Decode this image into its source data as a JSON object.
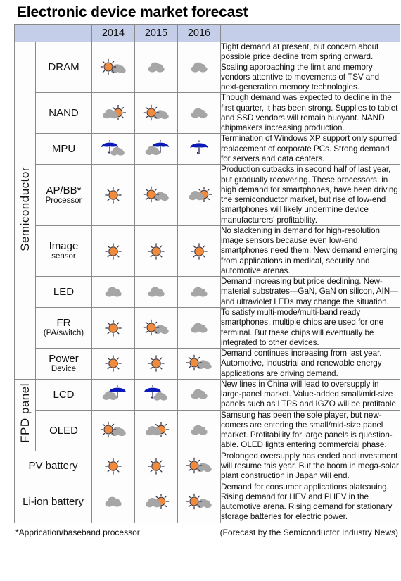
{
  "title": "Electronic device market forecast",
  "colors": {
    "header_band": "#c5cee8",
    "sun": "#f08a3c",
    "cloud": "#a6a6a6",
    "umbrella": "#0b19b9",
    "grid": "#8a8a8a"
  },
  "header": {
    "blank_label": "",
    "years": [
      "2014",
      "2015",
      "2016"
    ],
    "desc_label": ""
  },
  "groups": [
    {
      "label": "Semiconductor",
      "row_count": 8
    },
    {
      "label": "FPD panel",
      "row_count": 2
    }
  ],
  "rows": [
    {
      "group": "Semiconductor",
      "name": "DRAM",
      "sub": "",
      "icons": [
        "sun-cloud",
        "cloud",
        "cloud"
      ],
      "description": "Tight demand at present, but concern about possible price decline from spring onward. Scaling approaching the limit and memory vendors attentive to movements of TSV and next-generation memory technologies."
    },
    {
      "group": "Semiconductor",
      "name": "NAND",
      "sub": "",
      "icons": [
        "cloud-sun",
        "sun-cloud",
        "cloud"
      ],
      "description": "Though demand was expected to decline in the first quarter, it has been strong. Supplies to tablet and SSD vendors will remain buoyant. NAND chipmakers increasing production."
    },
    {
      "group": "Semiconductor",
      "name": "MPU",
      "sub": "",
      "icons": [
        "umbrella-cloud",
        "cloud-umbrella",
        "umbrella"
      ],
      "description": "Termination of Windows XP support only spurred replacement of corporate PCs. Strong demand for servers and data centers."
    },
    {
      "group": "Semiconductor",
      "name": "AP/BB*",
      "sub": "Processor",
      "icons": [
        "sun",
        "sun-cloud",
        "cloud-sun"
      ],
      "description": "Production cutbacks in second half of last year, but gradually recovering. These processors, in high demand for smartphones, have been driving the semiconductor market, but rise of low-end smartphones will likely undermine device manufacturers’ profitability."
    },
    {
      "group": "Semiconductor",
      "name": "Image",
      "sub": "sensor",
      "icons": [
        "sun",
        "sun",
        "sun"
      ],
      "description": "No slackening in demand for high-resolution image sensors because even low-end smartphones need them. New demand emerging from applications in medical, security and automotive arenas."
    },
    {
      "group": "Semiconductor",
      "name": "LED",
      "sub": "",
      "icons": [
        "cloud",
        "cloud",
        "cloud"
      ],
      "description": "Demand increasing but price declining. New-material substrates—GaN, GaN on silicon, AIN—and ultraviolet LEDs may change the situation."
    },
    {
      "group": "Semiconductor",
      "name": "FR",
      "sub": "(PA/switch)",
      "icons": [
        "sun",
        "sun-cloud",
        "cloud"
      ],
      "description": "To satisfy multi-mode/multi-band ready smartphones, multiple chips are used for one terminal. But these chips will eventually be integrated to other devices."
    },
    {
      "group": "Semiconductor",
      "name": "Power",
      "sub": "Device",
      "icons": [
        "sun",
        "sun",
        "sun-cloud"
      ],
      "description": "Demand continues increasing from last year. Automotive, industrial and renewable energy applications are driving demand."
    },
    {
      "group": "FPD panel",
      "name": "LCD",
      "sub": "",
      "icons": [
        "cloud-umbrella",
        "umbrella-cloud",
        "cloud"
      ],
      "description": "New lines in China will lead to oversupply in large-panel market. Value-added small/mid-size panels such as LTPS and IGZO will be profitable."
    },
    {
      "group": "FPD panel",
      "name": "OLED",
      "sub": "",
      "icons": [
        "sun-cloud",
        "cloud-sun",
        "cloud"
      ],
      "description": "Samsung has been the sole player, but new-comers are entering the small/mid-size panel market. Profitability for large panels is question-able. OLED lights entering commercial phase."
    },
    {
      "group": "",
      "name": "PV battery",
      "sub": "",
      "icons": [
        "sun",
        "sun",
        "sun-cloud"
      ],
      "description": "Prolonged oversupply has ended and investment will resume this year. But the boom in mega-solar plant construction in Japan will end."
    },
    {
      "group": "",
      "name": "Li-ion battery",
      "sub": "",
      "icons": [
        "cloud",
        "cloud-sun",
        "sun-cloud"
      ],
      "description": "Demand for consumer applications plateauing. Rising demand for HEV and PHEV in the automotive arena. Rising demand for stationary storage batteries for electric power."
    }
  ],
  "footnote": "*Apprication/baseband processor",
  "source": "(Forecast by the Semiconductor Industry News)"
}
